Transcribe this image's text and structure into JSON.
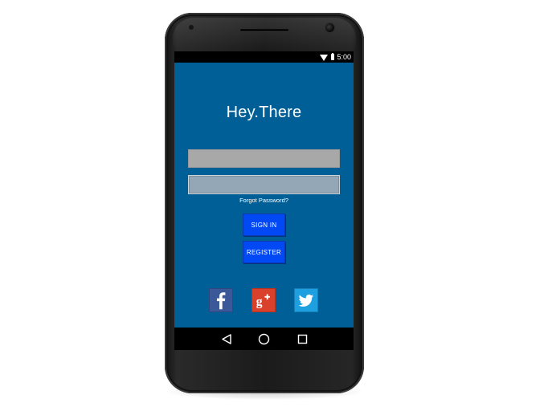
{
  "status_bar": {
    "time": "5:00",
    "icons": [
      "wifi-icon",
      "battery-icon"
    ]
  },
  "app": {
    "title": "Hey.There",
    "username": {
      "value": "",
      "placeholder": ""
    },
    "password": {
      "value": "",
      "placeholder": ""
    },
    "forgot_password_label": "Forgot Password?",
    "sign_in_label": "SIGN IN",
    "register_label": "REGISTER",
    "social_buttons": [
      {
        "name": "facebook-icon",
        "color": "#3b5998"
      },
      {
        "name": "google-plus-icon",
        "color": "#d9412d"
      },
      {
        "name": "twitter-icon",
        "color": "#1d9fe0"
      }
    ],
    "background_color": "#005f97",
    "button_color": "#0049f5"
  },
  "nav_bar": {
    "icons": [
      "back-icon",
      "home-icon",
      "recent-apps-icon"
    ]
  }
}
